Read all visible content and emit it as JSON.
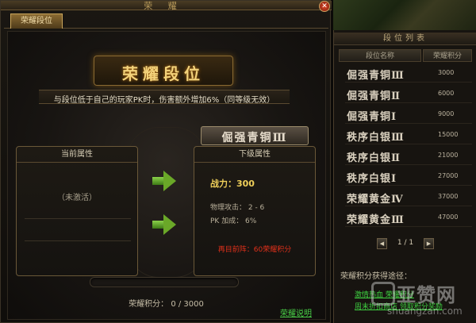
{
  "window": {
    "title": "荣 耀"
  },
  "tabs": [
    {
      "label": "荣耀段位"
    }
  ],
  "rank": {
    "banner_title": "荣耀段位",
    "description": "与段位低于自己的玩家PK时，伤害额外增加6%（同等级无效）"
  },
  "current": {
    "header": "当前属性",
    "status": "（未激活）"
  },
  "next": {
    "rank_name": "倔强青铜Ⅲ",
    "header": "下级属性",
    "power_label": "战力：",
    "power_value": "300",
    "stat1": "物理攻击： 2 - 6",
    "stat2": "PK  加成： 6%",
    "cost": "再目前阵：60荣耀积分"
  },
  "progress": {
    "label": "荣耀积分： 0 / 3000",
    "value": 0,
    "max": 3000
  },
  "help_link": "荣耀说明",
  "side": {
    "title": "段位列表",
    "col_name": "段位名称",
    "col_points": "荣耀积分",
    "ranks": [
      {
        "name": "倔强青铜Ⅲ",
        "points": "3000"
      },
      {
        "name": "倔强青铜Ⅱ",
        "points": "6000"
      },
      {
        "name": "倔强青铜Ⅰ",
        "points": "9000"
      },
      {
        "name": "秩序白银Ⅲ",
        "points": "15000"
      },
      {
        "name": "秩序白银Ⅱ",
        "points": "21000"
      },
      {
        "name": "秩序白银Ⅰ",
        "points": "27000"
      },
      {
        "name": "荣耀黄金Ⅳ",
        "points": "37000"
      },
      {
        "name": "荣耀黄金Ⅲ",
        "points": "47000"
      }
    ],
    "pager": {
      "text": "1 / 1",
      "prev": "◀",
      "next": "▶"
    },
    "earn_title": "荣耀积分获得途径：",
    "earn_links": [
      "激情热血 荣耀积分",
      "周末折扣商店 领取积分奖励"
    ]
  },
  "watermark": {
    "main": "亚赞网",
    "sub": "shuangzan.com"
  },
  "colors": {
    "accent_gold": "#f3d27a",
    "link_green": "#4ad048",
    "cost_red": "#e0301a",
    "arrow_green": "#6aa828"
  }
}
